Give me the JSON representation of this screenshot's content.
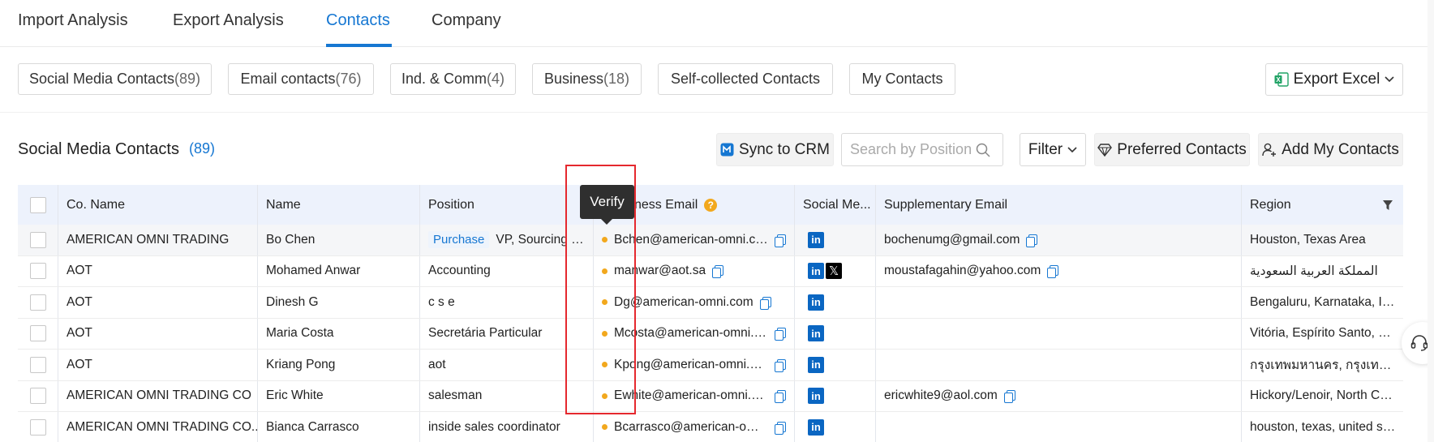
{
  "nav": {
    "tabs": [
      {
        "label": "Import Analysis"
      },
      {
        "label": "Export Analysis"
      },
      {
        "label": "Contacts"
      },
      {
        "label": "Company"
      }
    ],
    "active_tab": "Contacts"
  },
  "categories": [
    {
      "label": "Social Media Contacts",
      "count": "(89)"
    },
    {
      "label": "Email contacts",
      "count": "(76)"
    },
    {
      "label": "Ind. & Comm",
      "count": "(4)"
    },
    {
      "label": "Business",
      "count": "(18)"
    },
    {
      "label": "Self-collected Contacts",
      "count": ""
    },
    {
      "label": "My Contacts",
      "count": ""
    }
  ],
  "export_label": "Export Excel",
  "section": {
    "title": "Social Media Contacts",
    "count": "(89)",
    "sync_label": "Sync to CRM",
    "search_placeholder": "Search by Position",
    "filter_label": "Filter",
    "preferred_label": "Preferred Contacts",
    "add_label": "Add My Contacts"
  },
  "table": {
    "columns": {
      "co_name": "Co. Name",
      "name": "Name",
      "position": "Position",
      "business_email": "ness Email",
      "social": "Social Me...",
      "supplementary": "Supplementary Email",
      "region": "Region"
    },
    "rows": [
      {
        "company": "AMERICAN OMNI TRADING",
        "name": "Bo Chen",
        "tag": "Purchase",
        "position": "VP, Sourcing and...",
        "email": "Bchen@american-omni.com",
        "social": [
          "linkedin"
        ],
        "supp": "bochenumg@gmail.com",
        "region": "Houston, Texas Area"
      },
      {
        "company": "AOT",
        "name": "Mohamed Anwar",
        "tag": "",
        "position": "Accounting",
        "email": "manwar@aot.sa",
        "social": [
          "linkedin",
          "x"
        ],
        "supp": "moustafagahin@yahoo.com",
        "region": "المملكة العربية السعودية"
      },
      {
        "company": "AOT",
        "name": "Dinesh G",
        "tag": "",
        "position": "c s e",
        "email": "Dg@american-omni.com",
        "social": [
          "linkedin"
        ],
        "supp": "",
        "region": "Bengaluru, Karnataka, India"
      },
      {
        "company": "AOT",
        "name": "Maria Costa",
        "tag": "",
        "position": "Secretária Particular",
        "email": "Mcosta@american-omni.com",
        "social": [
          "linkedin"
        ],
        "supp": "",
        "region": "Vitória, Espírito Santo, Brazil"
      },
      {
        "company": "AOT",
        "name": "Kriang Pong",
        "tag": "",
        "position": "aot",
        "email": "Kpong@american-omni.com",
        "social": [
          "linkedin"
        ],
        "supp": "",
        "region": "กรุงเทพมหานคร, กรุงเทพมหานคร"
      },
      {
        "company": "AMERICAN OMNI TRADING CO",
        "name": "Eric White",
        "tag": "",
        "position": "salesman",
        "email": "Ewhite@american-omni.com",
        "social": [
          "linkedin"
        ],
        "supp": "ericwhite9@aol.com",
        "region": "Hickory/Lenoir, North Carolina"
      },
      {
        "company": "AMERICAN OMNI TRADING CO...",
        "name": "Bianca Carrasco",
        "tag": "",
        "position": "inside sales coordinator",
        "email": "Bcarrasco@american-omni.com",
        "social": [
          "linkedin"
        ],
        "supp": "",
        "region": "houston, texas, united states"
      }
    ]
  },
  "tooltip": "Verify",
  "colors": {
    "accent": "#1677d2",
    "linkedin": "#0a66c2",
    "status_dot": "#f2a81d",
    "highlight": "#e5282e"
  }
}
